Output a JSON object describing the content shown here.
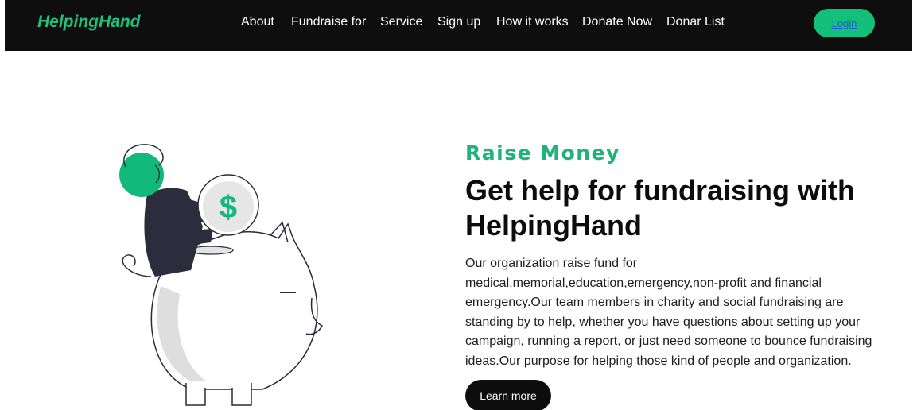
{
  "header": {
    "brand": "HelpingHand",
    "nav": [
      "About",
      "Fundraise for",
      "Service",
      "Sign up",
      "How it works",
      "Donate Now",
      "Donar List"
    ],
    "login_label": "Login"
  },
  "hero": {
    "eyebrow": "Raise Money",
    "headline": "Get help for fundraising with HelpingHand",
    "description": "Our organization raise fund for medical,memorial,education,emergency,non-profit and financial emergency.Our team members in charity and social fundraising are standing by to help, whether you have questions about setting up your campaign, running a report, or just need someone to bounce fundraising ideas.Our purpose for helping those kind of people and organization.",
    "cta_label": "Learn more"
  },
  "illustration": {
    "coin_symbol": "$"
  },
  "colors": {
    "brand_green": "#1fbf7d",
    "nav_bg": "#0e0e0e",
    "button_dark": "#0d0d0d"
  }
}
